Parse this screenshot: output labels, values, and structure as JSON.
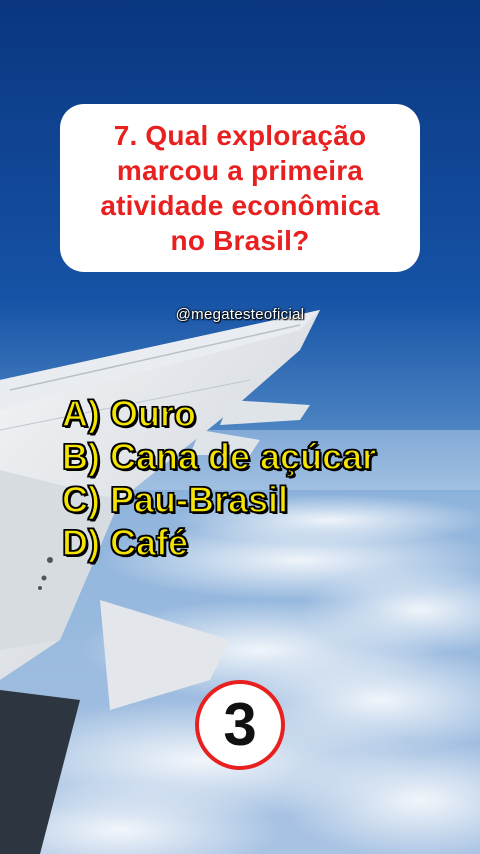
{
  "question": {
    "lines": [
      "7. Qual exploração",
      "marcou a primeira",
      "atividade econômica",
      "no Brasil?"
    ]
  },
  "handle": "@megatesteoficial",
  "options": [
    {
      "label": "A) Ouro"
    },
    {
      "label": "B) Cana de açúcar"
    },
    {
      "label": "C) Pau-Brasil"
    },
    {
      "label": "D) Café"
    }
  ],
  "timer": "3",
  "colors": {
    "question_text": "#e8201f",
    "option_text": "#f5e400",
    "timer_border": "#e8201f",
    "sky_top": "#0b3b86",
    "sky_bottom": "#5f93c9"
  }
}
